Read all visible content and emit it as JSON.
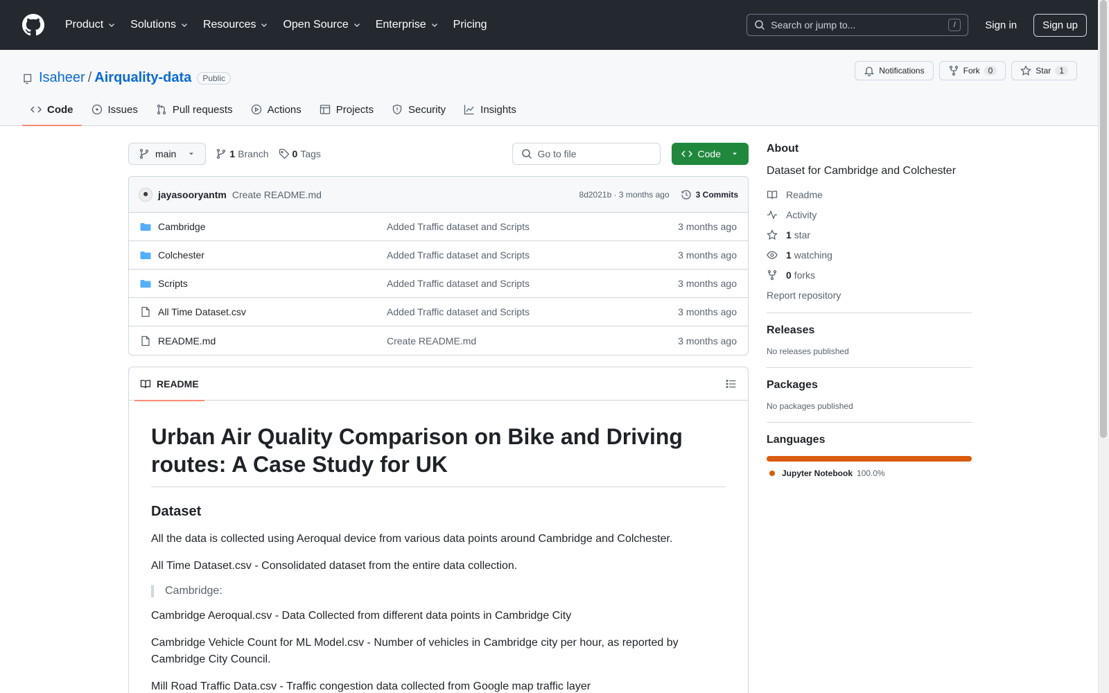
{
  "header": {
    "nav": [
      "Product",
      "Solutions",
      "Resources",
      "Open Source",
      "Enterprise",
      "Pricing"
    ],
    "search_placeholder": "Search or jump to...",
    "search_key": "/",
    "sign_in": "Sign in",
    "sign_up": "Sign up"
  },
  "repo": {
    "owner": "Isaheer",
    "sep": "/",
    "name": "Airquality-data",
    "visibility": "Public",
    "notifications": "Notifications",
    "fork_label": "Fork",
    "fork_count": "0",
    "star_label": "Star",
    "star_count": "1"
  },
  "tabs": [
    "Code",
    "Issues",
    "Pull requests",
    "Actions",
    "Projects",
    "Security",
    "Insights"
  ],
  "toolbar": {
    "branch": "main",
    "branch_count": "1",
    "branch_label": "Branch",
    "tag_count": "0",
    "tag_label": "Tags",
    "goto_placeholder": "Go to file",
    "code_label": "Code"
  },
  "commit": {
    "author": "jayasooryantm",
    "message": "Create README.md",
    "meta": "8d2021b · 3 months ago",
    "commits": "3 Commits"
  },
  "files": [
    {
      "name": "Cambridge",
      "type": "dir",
      "commit": "Added Traffic dataset and Scripts",
      "date": "3 months ago"
    },
    {
      "name": "Colchester",
      "type": "dir",
      "commit": "Added Traffic dataset and Scripts",
      "date": "3 months ago"
    },
    {
      "name": "Scripts",
      "type": "dir",
      "commit": "Added Traffic dataset and Scripts",
      "date": "3 months ago"
    },
    {
      "name": "All Time Dataset.csv",
      "type": "file",
      "commit": "Added Traffic dataset and Scripts",
      "date": "3 months ago"
    },
    {
      "name": "README.md",
      "type": "file",
      "commit": "Create README.md",
      "date": "3 months ago"
    }
  ],
  "readme": {
    "tab": "README",
    "title": "Urban Air Quality Comparison on Bike and Driving routes: A Case Study for UK",
    "h2": "Dataset",
    "p1": "All the data is collected using Aeroqual device from various data points around Cambridge and Colchester.",
    "p2": "All Time Dataset.csv - Consolidated dataset from the entire data collection.",
    "quote": "Cambridge:",
    "p3": "Cambridge Aeroqual.csv - Data Collected from different data points in Cambridge City",
    "p4": "Cambridge Vehicle Count for ML Model.csv - Number of vehicles in Cambridge city per hour, as reported by Cambridge City Council.",
    "p5": "Mill Road Traffic Data.csv - Traffic congestion data collected from Google map traffic layer"
  },
  "about": {
    "title": "About",
    "description": "Dataset for Cambridge and Colchester",
    "readme": "Readme",
    "activity": "Activity",
    "stars_n": "1",
    "stars": "star",
    "watching_n": "1",
    "watching": "watching",
    "forks_n": "0",
    "forks": "forks",
    "report": "Report repository"
  },
  "releases": {
    "title": "Releases",
    "text": "No releases published"
  },
  "packages": {
    "title": "Packages",
    "text": "No packages published"
  },
  "languages": {
    "title": "Languages",
    "name": "Jupyter Notebook",
    "pct": "100.0%",
    "color": "#DA5B0B"
  }
}
